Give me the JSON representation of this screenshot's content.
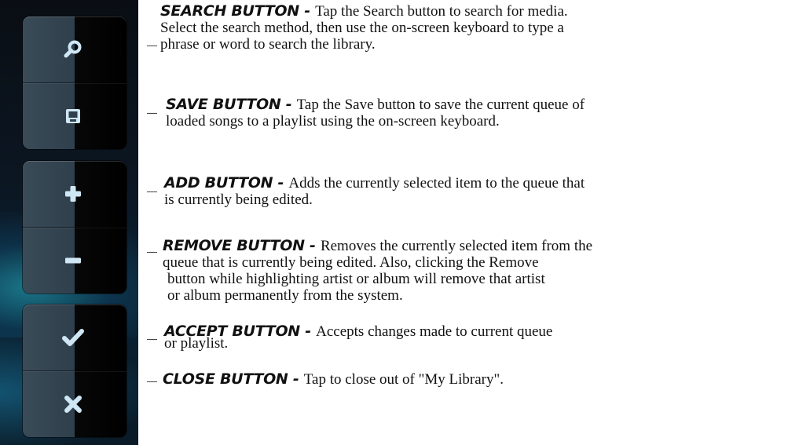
{
  "toolbar": {
    "buttons": [
      {
        "name": "search",
        "icon": "magnifier-icon"
      },
      {
        "name": "save",
        "icon": "save-disk-icon"
      },
      {
        "name": "add",
        "icon": "plus-icon"
      },
      {
        "name": "remove",
        "icon": "minus-icon"
      },
      {
        "name": "accept",
        "icon": "checkmark-icon"
      },
      {
        "name": "close",
        "icon": "x-icon"
      }
    ],
    "icon_color": "#cfe6f4"
  },
  "callouts": {
    "search": {
      "title": "SEARCH BUTTON - ",
      "line1": "Tap the Search button to search for media.",
      "line2": "Select the search method, then use the on-screen keyboard to type a",
      "line3": "phrase or word to search the library."
    },
    "save": {
      "title": "SAVE BUTTON - ",
      "line1": "Tap the Save button to save the current queue of",
      "line2": "loaded songs to a playlist using the on-screen keyboard."
    },
    "add": {
      "title": "ADD BUTTON - ",
      "line1": "Adds the currently selected item to the queue that",
      "line2": "is currently being edited."
    },
    "remove": {
      "title": "REMOVE BUTTON - ",
      "line1": "Removes the currently selected item from the",
      "line2": "queue that is currently being edited. Also, clicking the Remove",
      "line3": "button while highlighting artist or album will remove that artist",
      "line4": "or album permanently from the system."
    },
    "accept": {
      "title": "ACCEPT BUTTON - ",
      "line1": "Accepts changes made to current queue",
      "line2": "or playlist."
    },
    "close": {
      "title": "CLOSE BUTTON - ",
      "line1": "Tap to close out of \"My Library\"."
    }
  }
}
